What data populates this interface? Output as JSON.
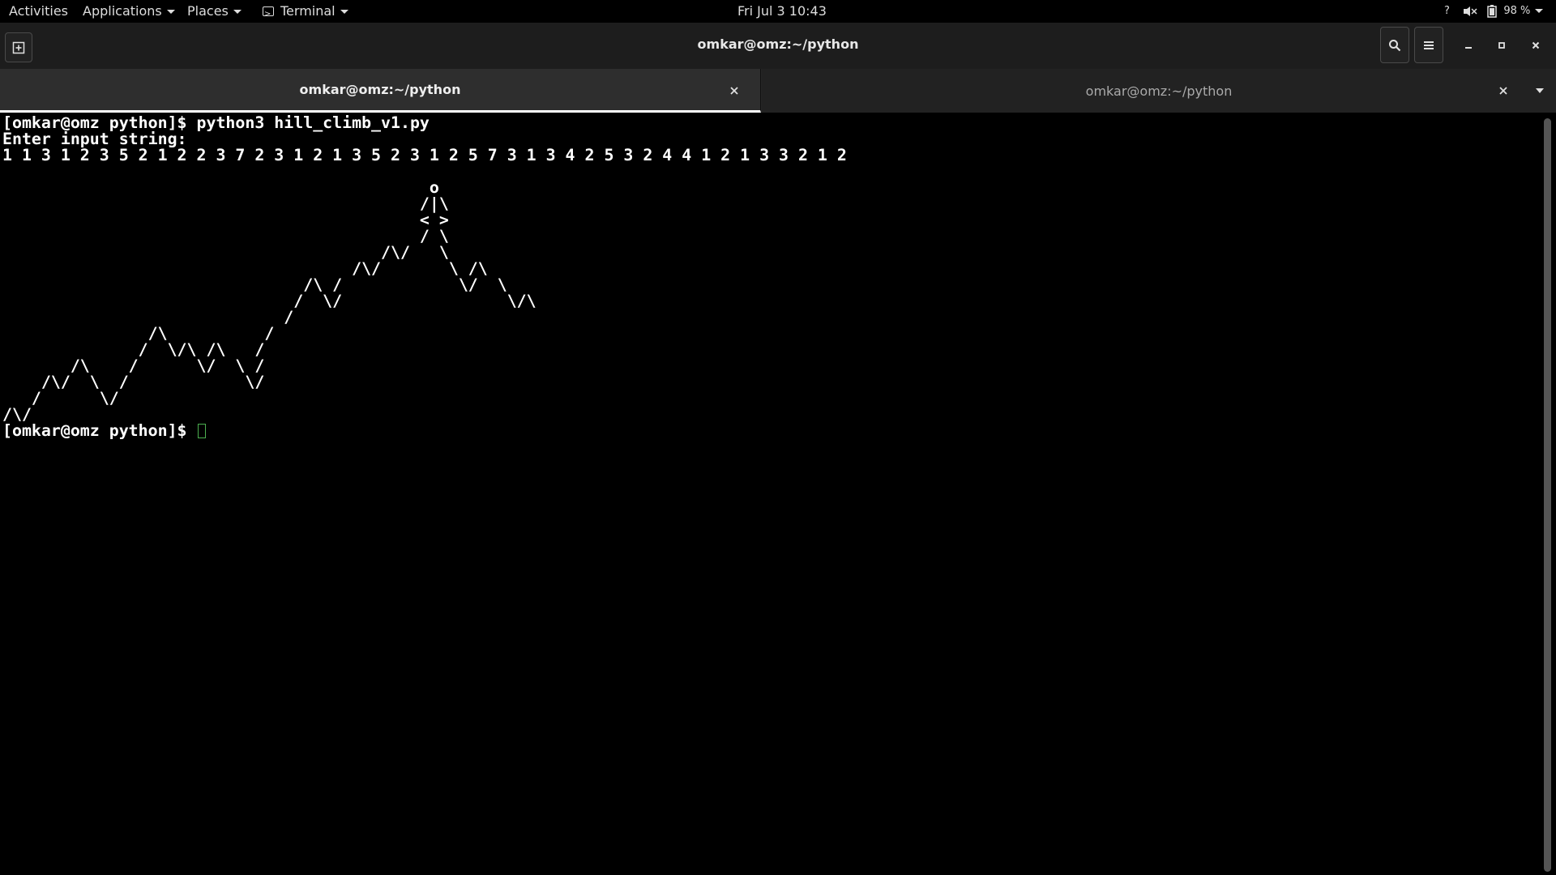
{
  "topbar": {
    "activities": "Activities",
    "applications": "Applications",
    "places": "Places",
    "app_menu": "Terminal",
    "clock": "Fri Jul 3  10:43",
    "battery": "98 %",
    "icons": [
      "help-icon",
      "volume-muted-icon",
      "battery-icon"
    ]
  },
  "window": {
    "title": "omkar@omz:~/python",
    "buttons": [
      "new-tab-icon",
      "search-icon",
      "hamburger-menu-icon",
      "minimize-icon",
      "maximize-icon",
      "close-icon"
    ]
  },
  "tabs": [
    {
      "label": "omkar@omz:~/python",
      "active": true
    },
    {
      "label": "omkar@omz:~/python",
      "active": false
    }
  ],
  "terminal": {
    "lines": [
      "[omkar@omz python]$ python3 hill_climb_v1.py",
      "Enter input string:",
      "1 1 3 1 2 3 5 2 1 2 2 3 7 2 3 1 2 1 3 5 2 3 1 2 5 7 3 1 3 4 2 5 3 2 4 4 1 2 1 3 3 2 1 2",
      "",
      "                                            o",
      "                                           /|\\",
      "                                           < >",
      "                                           / \\",
      "                                       /\\/   \\",
      "                                    /\\/       \\ /\\",
      "                               /\\ /            \\/  \\",
      "                              /  \\/                 \\/\\",
      "                             /",
      "               /\\          /",
      "              /  \\/\\ /\\   /",
      "       /\\    /      \\/  \\ /",
      "    /\\/  \\  /            \\/",
      "   /      \\/",
      "/\\/",
      "[omkar@omz python]$ "
    ]
  }
}
